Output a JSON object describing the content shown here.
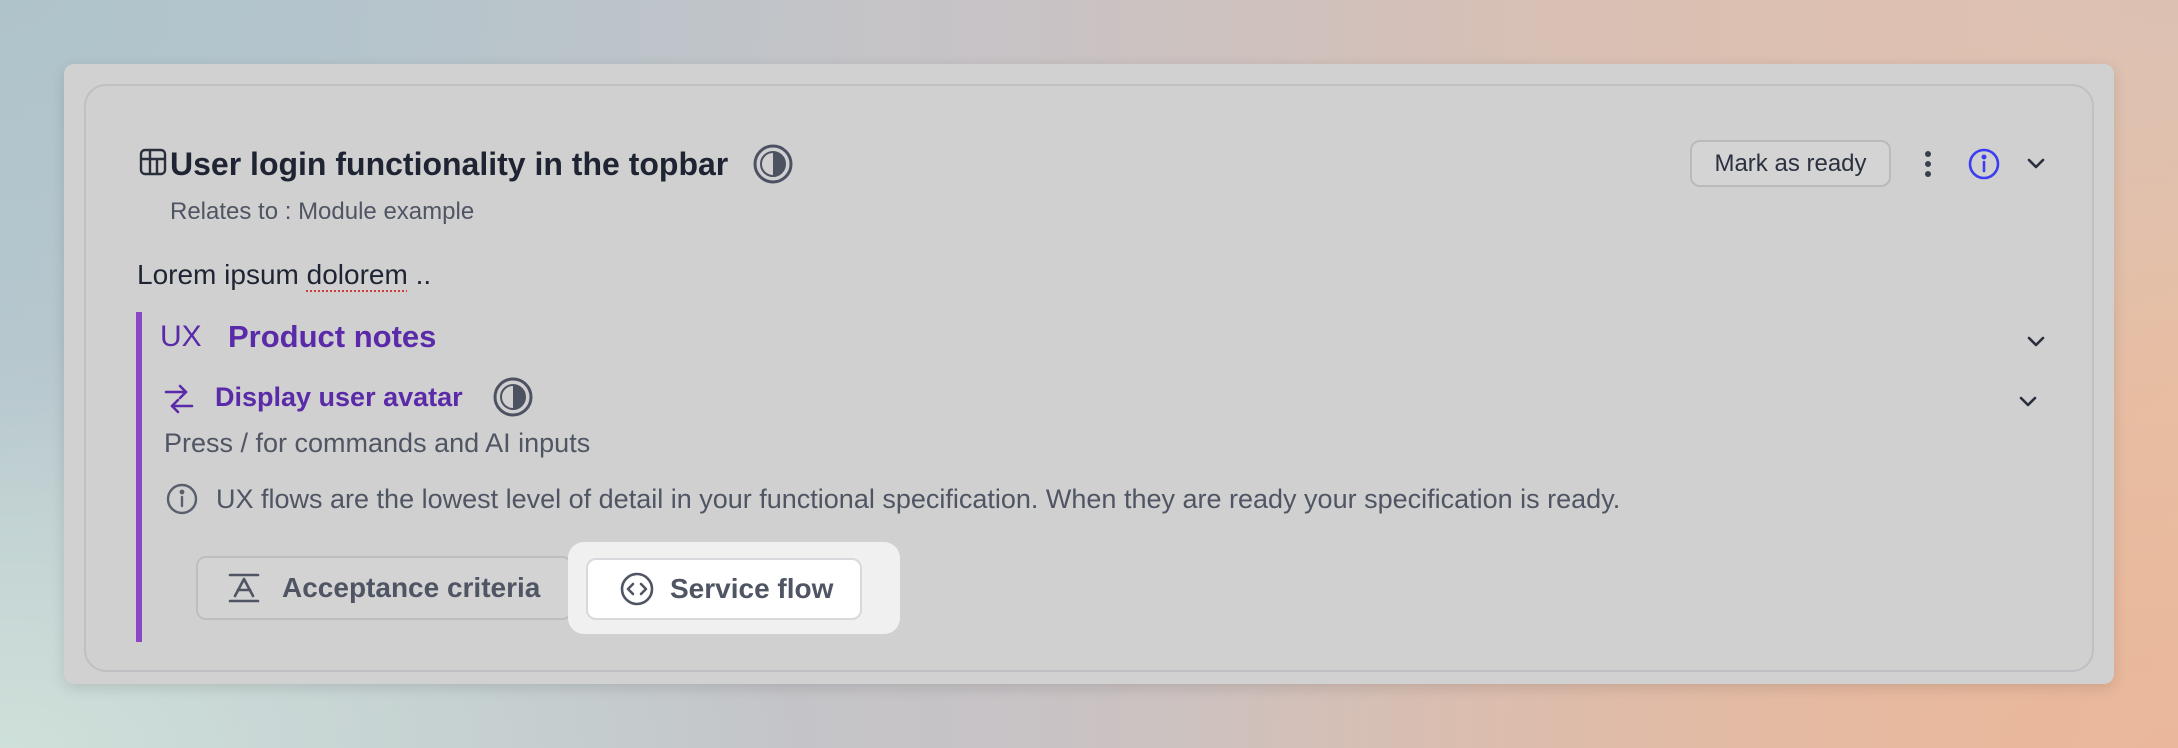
{
  "card": {
    "title": "User login functionality in the topbar",
    "relates": "Relates to : Module example",
    "mark_ready_label": "Mark as ready",
    "description": {
      "prefix": "Lorem ipsum ",
      "misspelled": "dolorem",
      "suffix": " .."
    }
  },
  "product_notes": {
    "tag": "UX",
    "title": "Product notes",
    "flow": {
      "title": "Display user avatar",
      "placeholder": "Press / for commands and AI inputs",
      "info_note": "UX flows are the lowest level of detail in your functional specification. When they are ready your specification is ready."
    },
    "buttons": {
      "acceptance_criteria": "Acceptance criteria",
      "service_flow": "Service flow"
    }
  },
  "icons": {
    "header": "grid-table-icon",
    "status": "half-circle-status-icon",
    "more": "more-vertical-icon",
    "info": "info-icon",
    "chevron": "chevron-down-icon",
    "flow": "arrows-exchange-icon",
    "criteria": "text-align-icon",
    "service": "code-circle-icon"
  },
  "colors": {
    "accent_purple": "#5b2aa8",
    "bar_purple": "#8a46c4",
    "info_blue": "#3b3ef0"
  }
}
